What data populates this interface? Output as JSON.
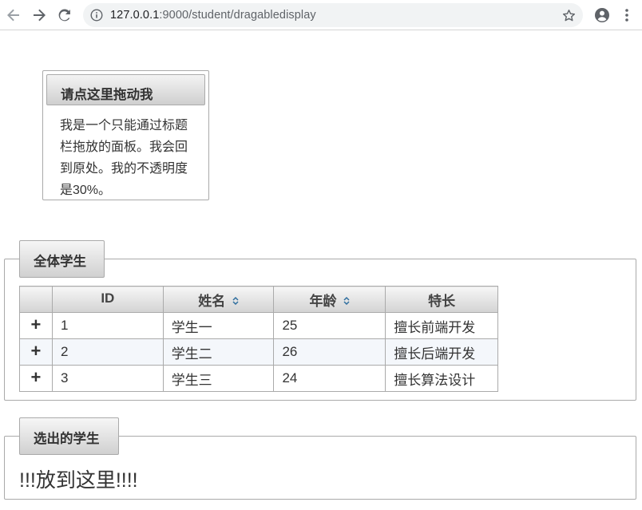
{
  "browser": {
    "url_host": "127.0.0.1",
    "url_rest": ":9000/student/dragabledisplay"
  },
  "drag_panel": {
    "title": "请点这里拖动我",
    "content": "我是一个只能通过标题栏拖放的面板。我会回到原处。我的不透明度是30%。"
  },
  "students_section": {
    "legend": "全体学生",
    "table": {
      "headers": [
        "",
        "ID",
        "姓名",
        "年龄",
        "特长"
      ],
      "rows": [
        {
          "expander": "+",
          "id": "1",
          "name": "学生一",
          "age": "25",
          "specialty": "擅长前端开发"
        },
        {
          "expander": "+",
          "id": "2",
          "name": "学生二",
          "age": "26",
          "specialty": "擅长后端开发"
        },
        {
          "expander": "+",
          "id": "3",
          "name": "学生三",
          "age": "24",
          "specialty": "擅长算法设计"
        }
      ]
    }
  },
  "selected_section": {
    "legend": "选出的学生",
    "drop_text": "!!!放到这里!!!!"
  },
  "colors": {
    "border": "#aaaaaa",
    "alt_row": "#f4f7fb",
    "sort_icon": "#2e6e9e"
  },
  "icons": {
    "back": "back-arrow-icon",
    "forward": "forward-arrow-icon",
    "reload": "reload-icon",
    "info": "info-icon",
    "star": "star-icon",
    "account": "account-icon",
    "menu": "kebab-menu-icon",
    "sort": "sort-icon",
    "expand": "plus-icon"
  }
}
